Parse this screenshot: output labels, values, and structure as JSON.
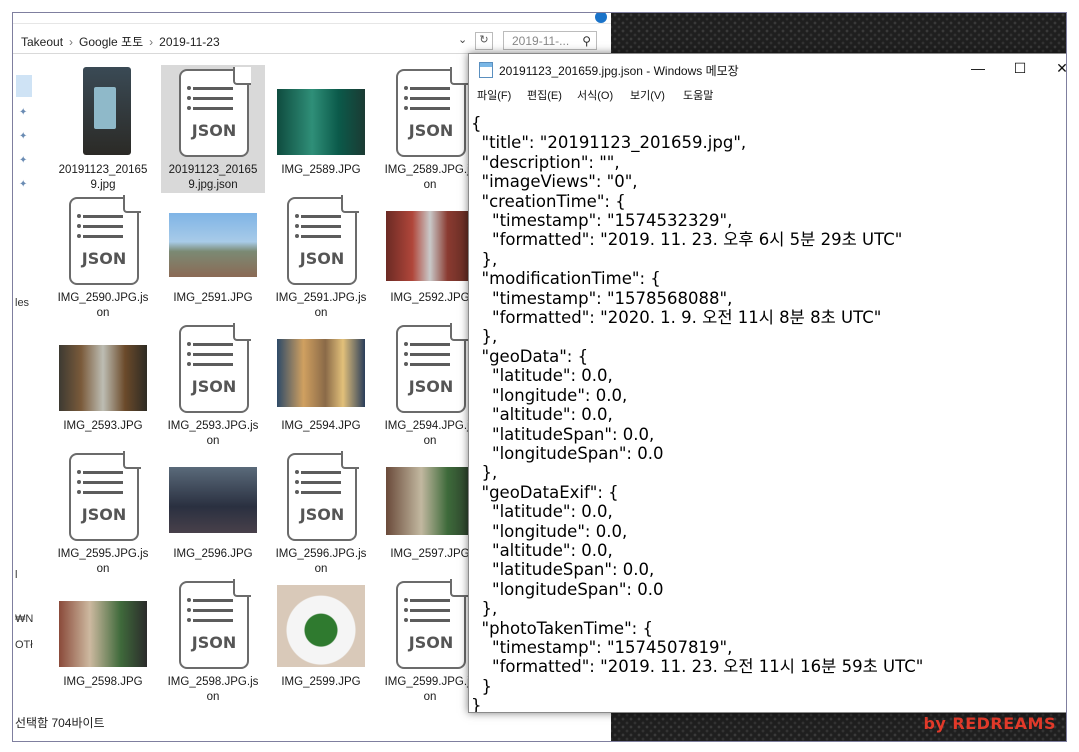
{
  "explorer": {
    "breadcrumb": [
      "Takeout",
      "Google 포토",
      "2019-11-23"
    ],
    "search_placeholder": "2019-11-...",
    "status_text": "선택함 704바이트",
    "left_fragments": [
      "les",
      "l",
      "₩N",
      "OTł"
    ],
    "files": [
      {
        "name": "20191123_20165\n9.jpg",
        "type": "photo",
        "thumb": "phone"
      },
      {
        "name": "20191123_20165\n9.jpg.json",
        "type": "json",
        "selected": true
      },
      {
        "name": "IMG_2589.JPG",
        "type": "photo",
        "thumb": "teal"
      },
      {
        "name": "IMG_2589.JPG.js\non",
        "type": "json"
      },
      {
        "name": "IMG_2590.JPG.js\non",
        "type": "json"
      },
      {
        "name": "IMG_2591.JPG",
        "type": "photo",
        "thumb": "sky"
      },
      {
        "name": "IMG_2591.JPG.js\non",
        "type": "json"
      },
      {
        "name": "IMG_2592.JPG",
        "type": "photo",
        "thumb": "street"
      },
      {
        "name": "IMG_2593.JPG",
        "type": "photo",
        "thumb": "street2"
      },
      {
        "name": "IMG_2593.JPG.js\non",
        "type": "json"
      },
      {
        "name": "IMG_2594.JPG",
        "type": "photo",
        "thumb": "bldg"
      },
      {
        "name": "IMG_2594.JPG.js\non",
        "type": "json"
      },
      {
        "name": "IMG_2595.JPG.js\non",
        "type": "json"
      },
      {
        "name": "IMG_2596.JPG",
        "type": "photo",
        "thumb": "city"
      },
      {
        "name": "IMG_2596.JPG.js\non",
        "type": "json"
      },
      {
        "name": "IMG_2597.JPG",
        "type": "photo",
        "thumb": "alley"
      },
      {
        "name": "IMG_2598.JPG",
        "type": "photo",
        "thumb": "alley2"
      },
      {
        "name": "IMG_2598.JPG.js\non",
        "type": "json"
      },
      {
        "name": "IMG_2599.JPG",
        "type": "photo",
        "thumb": "food"
      },
      {
        "name": "IMG_2599.JPG.js\non",
        "type": "json"
      }
    ],
    "json_icon_text": "JSON"
  },
  "notepad": {
    "title": "20191123_201659.jpg.json - Windows 메모장",
    "menu": [
      "파일(F)",
      "편집(E)",
      "서식(O)",
      "보기(V)",
      "도움말"
    ],
    "content": "{\n  \"title\": \"20191123_201659.jpg\",\n  \"description\": \"\",\n  \"imageViews\": \"0\",\n  \"creationTime\": {\n    \"timestamp\": \"1574532329\",\n    \"formatted\": \"2019. 11. 23. 오후 6시 5분 29초 UTC\"\n  },\n  \"modificationTime\": {\n    \"timestamp\": \"1578568088\",\n    \"formatted\": \"2020. 1. 9. 오전 11시 8분 8초 UTC\"\n  },\n  \"geoData\": {\n    \"latitude\": 0.0,\n    \"longitude\": 0.0,\n    \"altitude\": 0.0,\n    \"latitudeSpan\": 0.0,\n    \"longitudeSpan\": 0.0\n  },\n  \"geoDataExif\": {\n    \"latitude\": 0.0,\n    \"longitude\": 0.0,\n    \"altitude\": 0.0,\n    \"latitudeSpan\": 0.0,\n    \"longitudeSpan\": 0.0\n  },\n  \"photoTakenTime\": {\n    \"timestamp\": \"1574507819\",\n    \"formatted\": \"2019. 11. 23. 오전 11시 16분 59초 UTC\"\n  }\n}"
  },
  "watermark": "by REDREAMS",
  "colors": {
    "watermark": "#e23a2a",
    "selection": "#d9d9d9"
  }
}
